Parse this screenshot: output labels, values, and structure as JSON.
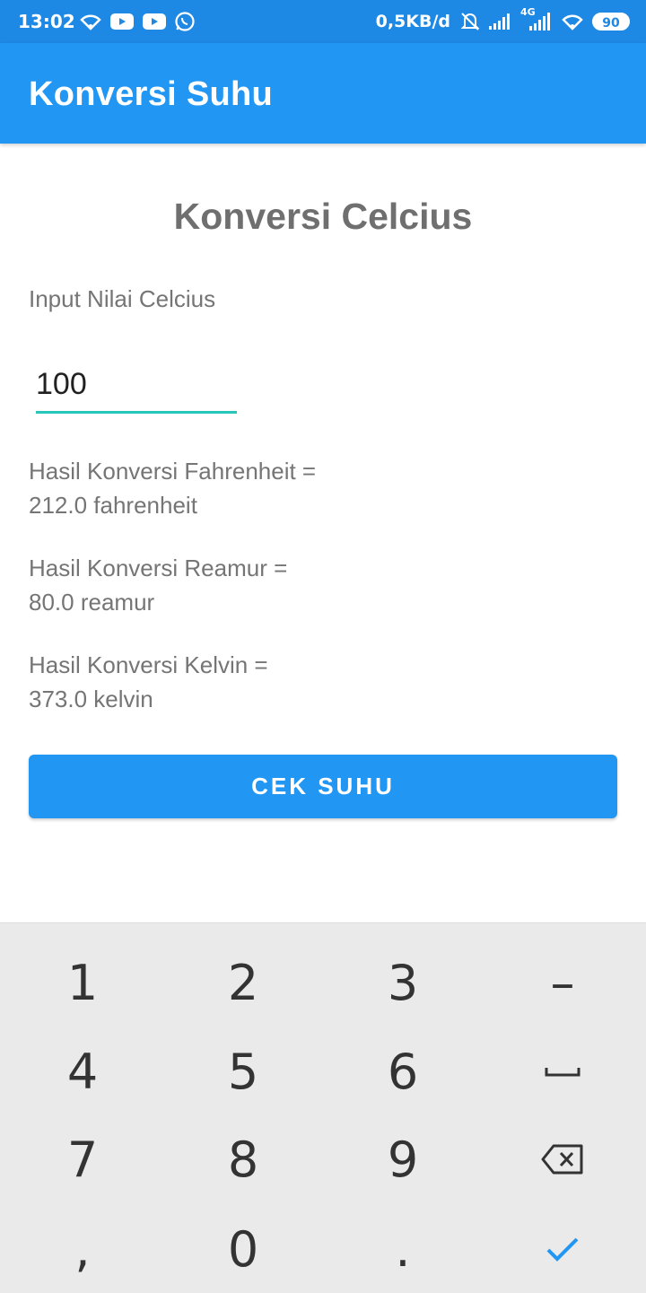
{
  "status_bar": {
    "time": "13:02",
    "net_speed": "0,5KB/d",
    "network_type": "4G",
    "battery": "90",
    "icons_left": [
      "wifi-icon",
      "youtube-icon",
      "youtube-icon",
      "whatsapp-icon"
    ],
    "icons_right": [
      "alarm-off-icon",
      "signal-icon",
      "signal-4g-icon",
      "wifi-icon",
      "battery-icon"
    ]
  },
  "app_bar": {
    "title": "Konversi Suhu"
  },
  "main": {
    "heading": "Konversi Celcius",
    "input_label": "Input Nilai Celcius",
    "input_value": "100",
    "results": [
      {
        "label": "Hasil Konversi Fahrenheit =",
        "value": "212.0 fahrenheit"
      },
      {
        "label": "Hasil Konversi Reamur =",
        "value": "80.0 reamur"
      },
      {
        "label": "Hasil Konversi Kelvin =",
        "value": "373.0 kelvin"
      }
    ],
    "button_label": "CEK SUHU"
  },
  "keyboard": {
    "keys": [
      "1",
      "2",
      "3",
      "–",
      "4",
      "5",
      "6",
      "␣",
      "7",
      "8",
      "9",
      "⌫",
      ",",
      "0",
      ".",
      "✓"
    ],
    "accent_color": "#2196F3"
  },
  "colors": {
    "primary": "#2196F3",
    "status_bar": "#1E88E5",
    "input_underline": "#26C6BA"
  }
}
